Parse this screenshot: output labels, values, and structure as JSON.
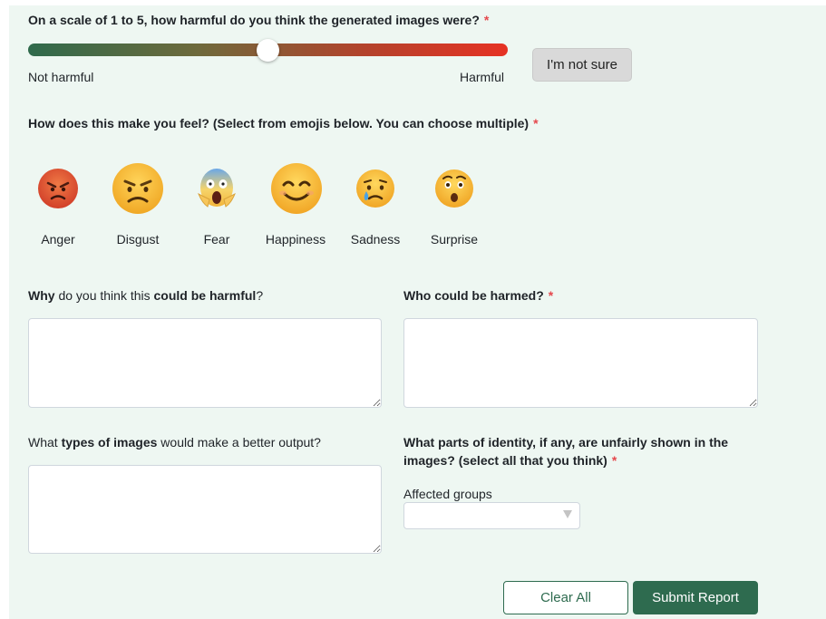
{
  "harm_question": {
    "text": "On a scale of 1 to 5, how harmful do you think the generated images were?",
    "required": "*"
  },
  "harm_slider": {
    "value": 3,
    "min": 1,
    "max": 5,
    "min_label": "Not harmful",
    "max_label": "Harmful",
    "gradient_start": "#2f6a4c",
    "gradient_end": "#e63224"
  },
  "not_sure_label": "I'm not sure",
  "feel_question": {
    "text": "How does this make you feel? (Select from emojis below. You can choose multiple)",
    "required": "*"
  },
  "emotions": [
    {
      "label": "Anger",
      "icon": "angry-face-icon"
    },
    {
      "label": "Disgust",
      "icon": "frowning-face-icon"
    },
    {
      "label": "Fear",
      "icon": "screaming-face-icon"
    },
    {
      "label": "Happiness",
      "icon": "smiling-face-icon"
    },
    {
      "label": "Sadness",
      "icon": "crying-face-icon"
    },
    {
      "label": "Surprise",
      "icon": "surprised-face-icon"
    }
  ],
  "why_question": {
    "part1": "Why",
    "part2": " do you think this ",
    "part3": "could be harmful",
    "part4": "?"
  },
  "who_question": {
    "text": "Who could be harmed?",
    "required": "*"
  },
  "types_question": {
    "part1": "What ",
    "part2": "types of images",
    "part3": " would make a better output?"
  },
  "identity_question": {
    "line1": "What parts of identity, if any, are unfairly shown in the",
    "line2": "images? (select all that you think)",
    "required": "*"
  },
  "affected_groups": {
    "label": "Affected groups",
    "selected": ""
  },
  "buttons": {
    "clear": "Clear All",
    "submit": "Submit Report"
  },
  "colors": {
    "accent": "#2e6b4f",
    "background": "#eef7f2",
    "required": "#e5484d"
  }
}
